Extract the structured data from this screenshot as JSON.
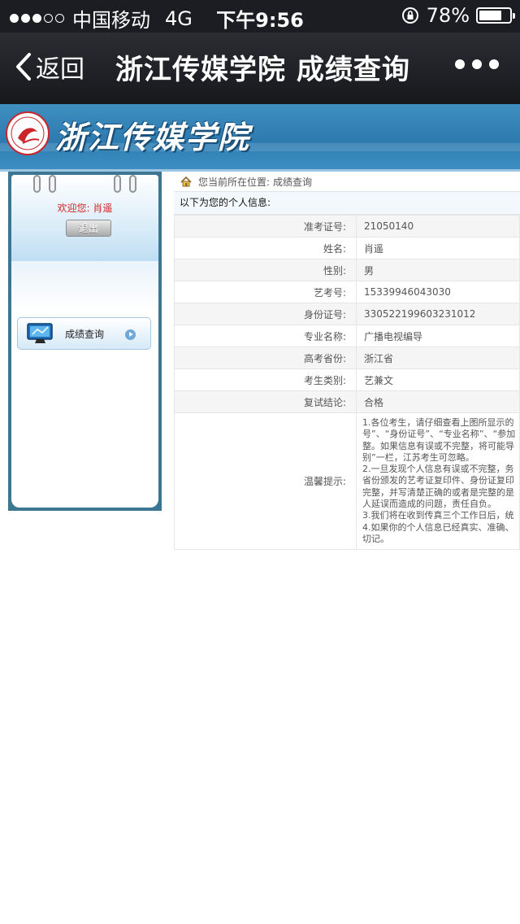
{
  "status_bar": {
    "carrier": "中国移动",
    "network": "4G",
    "time": "下午9:56",
    "battery_percent": "78%",
    "battery_level": 0.78
  },
  "nav": {
    "back_label": "返回",
    "title": "浙江传媒学院 成绩查询",
    "more_icon": "more-dots-icon"
  },
  "banner": {
    "school_name": "浙江传媒学院"
  },
  "sidebar": {
    "welcome_label": "欢迎您:",
    "user_name": "肖遥",
    "logout_label": "退出",
    "menu_item_label": "成绩查询"
  },
  "main": {
    "location_prefix": "您当前所在位置:",
    "location_page": "成绩查询",
    "info_title": "以下为您的个人信息:",
    "rows": [
      {
        "label": "准考证号:",
        "value": "21050140"
      },
      {
        "label": "姓名:",
        "value": "肖遥"
      },
      {
        "label": "性别:",
        "value": "男"
      },
      {
        "label": "艺考号:",
        "value": "15339946043030"
      },
      {
        "label": "身份证号:",
        "value": "330522199603231012"
      },
      {
        "label": "专业名称:",
        "value": "广播电视编导"
      },
      {
        "label": "高考省份:",
        "value": "浙江省"
      },
      {
        "label": "考生类别:",
        "value": "艺兼文"
      },
      {
        "label": "复试结论:",
        "value": "合格"
      }
    ],
    "notice_label": "温馨提示:",
    "notice_lines": [
      "1.各位考生，请仔细查看上图所显示的",
      "号”、“身份证号”、“专业名称”、“参加",
      "整。如果信息有误或不完整，将可能导",
      "别”一栏，江苏考生可忽略。",
      "2.一旦发现个人信息有误或不完整，务",
      "省份颁发的艺考证复印件、身份证复印",
      "完整，并写清楚正确的或者是完整的是",
      "人延误而造成的问题，责任自负。",
      "3.我们将在收到传真三个工作日后，统",
      "4.如果你的个人信息已经真实、准确、",
      "切记。"
    ]
  },
  "colors": {
    "nav_bg": "#1c1d22",
    "banner_blue": "#2e7bb0",
    "sidebar_frame": "#3d7690",
    "welcome_red": "#d42020"
  }
}
